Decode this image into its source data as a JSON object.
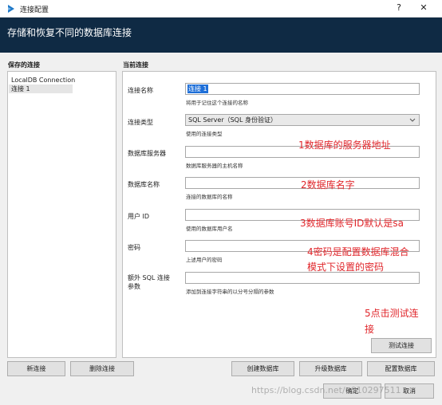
{
  "window": {
    "title": "连接配置",
    "help_glyph": "?",
    "close_glyph": "✕",
    "icon": "app-icon"
  },
  "banner": {
    "title": "存储和恢复不同的数据库连接"
  },
  "saved": {
    "label": "保存的连接",
    "items": [
      "LocalDB Connection",
      "连接 1"
    ],
    "selected_index": 1
  },
  "current": {
    "label": "当前连接",
    "fields": [
      {
        "label": "连接名称",
        "value": "连接 1",
        "hint": "将用于记住这个连接的名称"
      },
      {
        "label": "连接类型",
        "value": "SQL Server（SQL 身份验证）",
        "hint": "使用的连接类型"
      },
      {
        "label": "数据库服务器",
        "value": "",
        "hint": "数据库服务器的主机名称"
      },
      {
        "label": "数据库名称",
        "value": "",
        "hint": "连接的数据库的名称"
      },
      {
        "label": "用户 ID",
        "value": "",
        "hint": "使用的数据库用户名"
      },
      {
        "label": "密码",
        "value": "",
        "hint": "上述用户的密码"
      },
      {
        "label": "额外 SQL 连接参数",
        "value": "",
        "hint": "添加到连接字符串的以分号分隔的参数"
      }
    ],
    "test_button": "测试连接"
  },
  "annotations": {
    "a1": "1数据库的服务器地址",
    "a2": "2数据库名字",
    "a3": "3数据库账号ID默认是sa",
    "a4_line1": "4密码是配置数据库混合",
    "a4_line2": "模式下设置的密码",
    "a5_line1": "5点击测试连",
    "a5_line2": "接"
  },
  "buttons": {
    "new": "新连接",
    "delete": "删除连接",
    "create_db": "创建数据库",
    "upgrade_db": "升级数据库",
    "config_db": "配置数据库",
    "ok": "确定",
    "cancel": "取消"
  },
  "watermark": "https://blog.csdn.net/u010297511",
  "colors": {
    "banner": "#0f2a44",
    "annotation": "#e0262b",
    "selection": "#1e6fd8"
  }
}
